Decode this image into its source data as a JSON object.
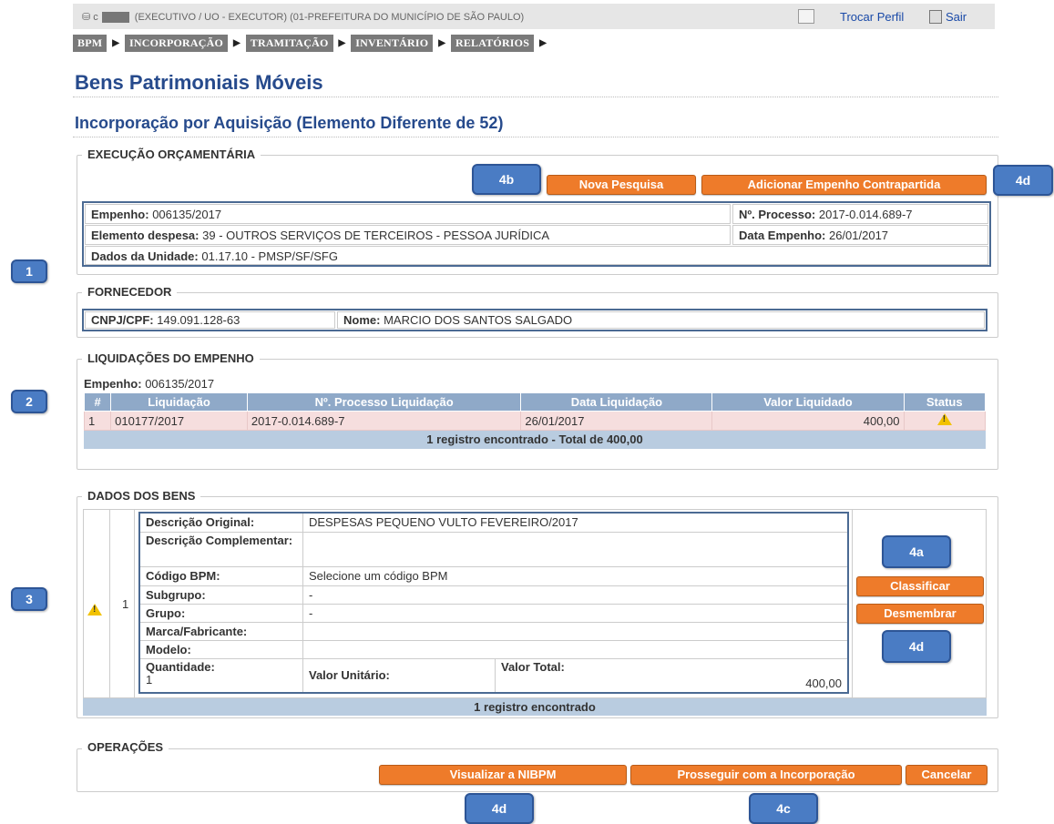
{
  "topbar": {
    "user_prefix": "⛁ c",
    "user_context": "(EXECUTIVO / UO - EXECUTOR) (01-PREFEITURA DO MUNICÍPIO DE SÃO PAULO)",
    "trocar_perfil": "Trocar Perfil",
    "sair": "Sair"
  },
  "menu": [
    "BPM",
    "INCORPORAÇÃO",
    "TRAMITAÇÃO",
    "INVENTÁRIO",
    "RELATÓRIOS"
  ],
  "menu_arrow": "▶",
  "page_title": "Bens Patrimoniais Móveis",
  "subtitle": "Incorporação por Aquisição (Elemento Diferente de 52)",
  "execucao": {
    "legend": "EXECUÇÃO ORÇAMENTÁRIA",
    "btn_nova": "Nova Pesquisa",
    "btn_adicionar": "Adicionar Empenho Contrapartida",
    "empenho_label": "Empenho:",
    "empenho_value": "006135/2017",
    "processo_label": "Nº. Processo:",
    "processo_value": "2017-0.014.689-7",
    "elemento_label": "Elemento despesa:",
    "elemento_value": "39 - OUTROS SERVIÇOS DE TERCEIROS - PESSOA JURÍDICA",
    "data_label": "Data Empenho:",
    "data_value": "26/01/2017",
    "unidade_label": "Dados da Unidade:",
    "unidade_value": "01.17.10 - PMSP/SF/SFG"
  },
  "fornecedor": {
    "legend": "FORNECEDOR",
    "cnpj_label": "CNPJ/CPF:",
    "cnpj_value": "149.091.128-63",
    "nome_label": "Nome:",
    "nome_value": "MARCIO DOS SANTOS SALGADO"
  },
  "liquidacoes": {
    "legend": "LIQUIDAÇÕES DO EMPENHO",
    "empenho_label": "Empenho:",
    "empenho_value": "006135/2017",
    "columns": [
      "#",
      "Liquidação",
      "Nº. Processo Liquidação",
      "Data Liquidação",
      "Valor Liquidado",
      "Status"
    ],
    "rows": [
      {
        "n": "1",
        "liquidacao": "010177/2017",
        "processo": "2017-0.014.689-7",
        "data": "26/01/2017",
        "valor": "400,00",
        "status_icon": "warning-icon"
      }
    ],
    "footer": "1 registro encontrado - Total de 400,00"
  },
  "bens": {
    "legend": "DADOS DOS BENS",
    "row_num": "1",
    "status_icon": "warning-icon",
    "descricao_original_label": "Descrição Original:",
    "descricao_original": "DESPESAS PEQUENO VULTO FEVEREIRO/2017",
    "descricao_comp_label": "Descrição Complementar:",
    "descricao_comp": "",
    "codigo_label": "Código BPM:",
    "codigo": "Selecione um código BPM",
    "subgrupo_label": "Subgrupo:",
    "subgrupo": "-",
    "grupo_label": "Grupo:",
    "grupo": "-",
    "marca_label": "Marca/Fabricante:",
    "marca": "",
    "modelo_label": "Modelo:",
    "modelo": "",
    "quantidade_label": "Quantidade:",
    "quantidade": "1",
    "valor_unitario_label": "Valor Unitário:",
    "valor_total_label": "Valor Total:",
    "valor_total": "400,00",
    "btn_classificar": "Classificar",
    "btn_desmembrar": "Desmembrar",
    "footer": "1 registro encontrado"
  },
  "operacoes": {
    "legend": "OPERAÇÕES",
    "btn_visualizar": "Visualizar a NIBPM",
    "btn_prosseguir": "Prosseguir com a Incorporação",
    "btn_cancelar": "Cancelar"
  },
  "callouts": {
    "c1": "1",
    "c2": "2",
    "c3": "3",
    "c4b": "4b",
    "c4d_top": "4d",
    "c4a": "4a",
    "c4d_mid": "4d",
    "c4d_bottom": "4d",
    "c4c": "4c"
  },
  "colors": {
    "title": "#264a8c",
    "button": "#ee7b2a",
    "callout": "#4a7cc4",
    "table_header": "#8fa9c8",
    "row_highlight": "#f6dede"
  }
}
